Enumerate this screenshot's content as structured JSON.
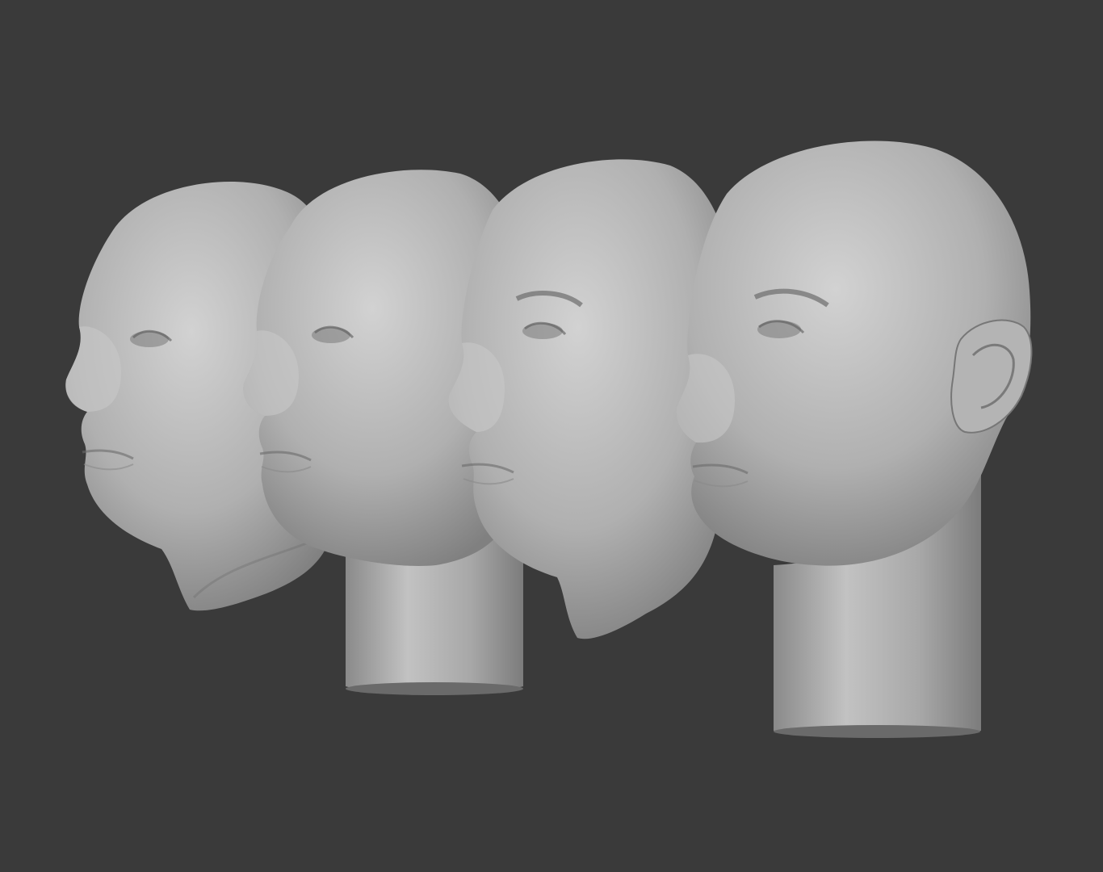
{
  "scene": {
    "background_color": "#3a3a3a",
    "material_color": "#a9a9a9",
    "model_count": 4,
    "models": [
      {
        "id": "head-1",
        "has_neck_stand": false,
        "has_ear": false,
        "has_eyebrow_detail": false
      },
      {
        "id": "head-2",
        "has_neck_stand": true,
        "has_ear": false,
        "has_eyebrow_detail": false
      },
      {
        "id": "head-3",
        "has_neck_stand": false,
        "has_ear": false,
        "has_eyebrow_detail": true
      },
      {
        "id": "head-4",
        "has_neck_stand": true,
        "has_ear": true,
        "has_eyebrow_detail": true
      }
    ]
  }
}
